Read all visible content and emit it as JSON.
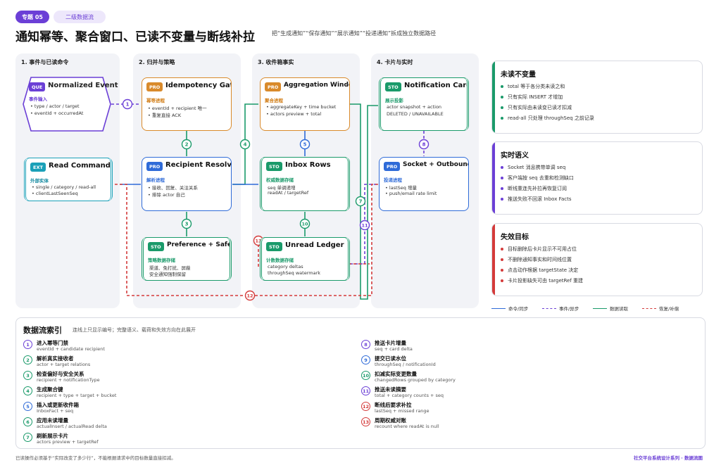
{
  "header": {
    "topic": "专题 05",
    "tag": "二级数据流",
    "title": "通知幂等、聚合窗口、已读不变量与断线补拉",
    "subtitle": "把“生成通知”“保存通知”“展示通知”“投递通知”拆成独立数据路径"
  },
  "columns": [
    {
      "title": "1. 事件与已读命令"
    },
    {
      "title": "2. 归并与策略"
    },
    {
      "title": "3. 收件箱事实"
    },
    {
      "title": "4. 卡片与实时"
    }
  ],
  "nodes": {
    "normalized_event": {
      "tag": "QUE",
      "title": "Normalized Event",
      "label": "事件输入",
      "lines": [
        "• type / actor / target",
        "• eventId + occurredAt"
      ]
    },
    "read_command": {
      "tag": "EXT",
      "title": "Read Command",
      "label": "外部实体",
      "lines": [
        "• single / category / read-all",
        "• clientLastSeenSeq"
      ]
    },
    "idempotency_gate": {
      "tag": "PRO",
      "title": "Idempotency Gate",
      "label": "幂等进程",
      "lines": [
        "• eventId + recipient 唯一",
        "• 重复直接 ACK"
      ]
    },
    "recipient_resolver": {
      "tag": "PRO",
      "title": "Recipient Resolver",
      "label": "解析进程",
      "lines": [
        "• 接收、回复、关注关系",
        "• 排除 actor 自己"
      ]
    },
    "preference_safety": {
      "tag": "STO",
      "title": "Preference + Safety",
      "label": "策略数据存储",
      "lines": [
        "渠道、免打扰、屏蔽",
        "安全通知强制保留"
      ]
    },
    "aggregation_window": {
      "tag": "PRO",
      "title": "Aggregation Window",
      "label": "聚合进程",
      "lines": [
        "• aggregateKey + time bucket",
        "• actors preview + total"
      ]
    },
    "inbox_rows": {
      "tag": "STO",
      "title": "Inbox Rows",
      "label": "权威数据存储",
      "lines": [
        "seq 单调递增",
        "readAt / targetRef"
      ]
    },
    "unread_ledger": {
      "tag": "STO",
      "title": "Unread Ledger",
      "label": "计数数据存储",
      "lines": [
        "category deltas",
        "throughSeq watermark"
      ]
    },
    "notification_card": {
      "tag": "STO",
      "title": "Notification Card",
      "label": "展示投影",
      "lines": [
        "actor snapshot + action",
        "DELETED / UNAVAILABLE"
      ]
    },
    "socket_outbound": {
      "tag": "PRO",
      "title": "Socket + Outbound",
      "label": "投递进程",
      "lines": [
        "• lastSeq 增量",
        "• push/email rate limit"
      ]
    }
  },
  "cards": [
    {
      "title": "未读不变量",
      "color": "#1a9a6a",
      "items": [
        "total 等于各分类未读之和",
        "只有实际 INSERT 才增加",
        "只有实际由未读变已读才扣减",
        "read-all 只处理 throughSeq 之前记录"
      ]
    },
    {
      "title": "实时语义",
      "color": "#6b3fd6",
      "items": [
        "Socket 消息携带单调 seq",
        "客户端按 seq 去重和检测缺口",
        "断线重连先补拉再恢复订阅",
        "推送失败不回滚 Inbox Facts"
      ]
    },
    {
      "title": "失效目标",
      "color": "#d43a3a",
      "items": [
        "目标删除后卡片显示不可用占位",
        "不删除通知事实和时间线位置",
        "点击动作根据 targetState 决定",
        "卡片投影缺失可由 targetRef 重建"
      ]
    }
  ],
  "legend": [
    "命令/同步",
    "事件/异步",
    "数据读取",
    "恢复/补偿"
  ],
  "colors": {
    "command": "#2f6bd8",
    "event": "#6b3fd6",
    "read": "#1a9a6a",
    "recovery": "#d43a3a"
  },
  "index": {
    "title": "数据流索引",
    "subtitle": "连线上只显示编号；完整语义、载荷和失效方向在此展开",
    "entries": [
      {
        "n": "1",
        "title": "进入幂等门禁",
        "desc": "eventId + candidate recipient",
        "color": "#6b3fd6"
      },
      {
        "n": "2",
        "title": "解析真实接收者",
        "desc": "actor + target relations",
        "color": "#1a9a6a"
      },
      {
        "n": "3",
        "title": "检查偏好与安全关系",
        "desc": "recipient + notificationType",
        "color": "#1a9a6a"
      },
      {
        "n": "4",
        "title": "生成聚合键",
        "desc": "recipient + type + target + bucket",
        "color": "#1a9a6a"
      },
      {
        "n": "5",
        "title": "插入或更新收件箱",
        "desc": "InboxFact + seq",
        "color": "#2f6bd8"
      },
      {
        "n": "6",
        "title": "应用未读增量",
        "desc": "actualInsert / actualRead delta",
        "color": "#1a9a6a"
      },
      {
        "n": "7",
        "title": "刷新展示卡片",
        "desc": "actors preview + targetRef",
        "color": "#1a9a6a"
      },
      {
        "n": "8",
        "title": "推送卡片增量",
        "desc": "seq + card delta",
        "color": "#6b3fd6"
      },
      {
        "n": "9",
        "title": "提交已读水位",
        "desc": "throughSeq / notificationId",
        "color": "#2f6bd8"
      },
      {
        "n": "10",
        "title": "扣减实际变更数量",
        "desc": "changedRows grouped by category",
        "color": "#1a9a6a"
      },
      {
        "n": "11",
        "title": "推送未读摘要",
        "desc": "total + category counts + seq",
        "color": "#6b3fd6"
      },
      {
        "n": "12",
        "title": "断线后要求补拉",
        "desc": "lastSeq + missed range",
        "color": "#d43a3a"
      },
      {
        "n": "13",
        "title": "周期权威对账",
        "desc": "recount where readAt is null",
        "color": "#d43a3a"
      }
    ]
  },
  "footer": {
    "left": "已读操作必须基于“实际改变了多少行”，不能根据请求中的目标数量直接扣减。",
    "right": "社交平台系统设计系列 · 数据流图"
  }
}
